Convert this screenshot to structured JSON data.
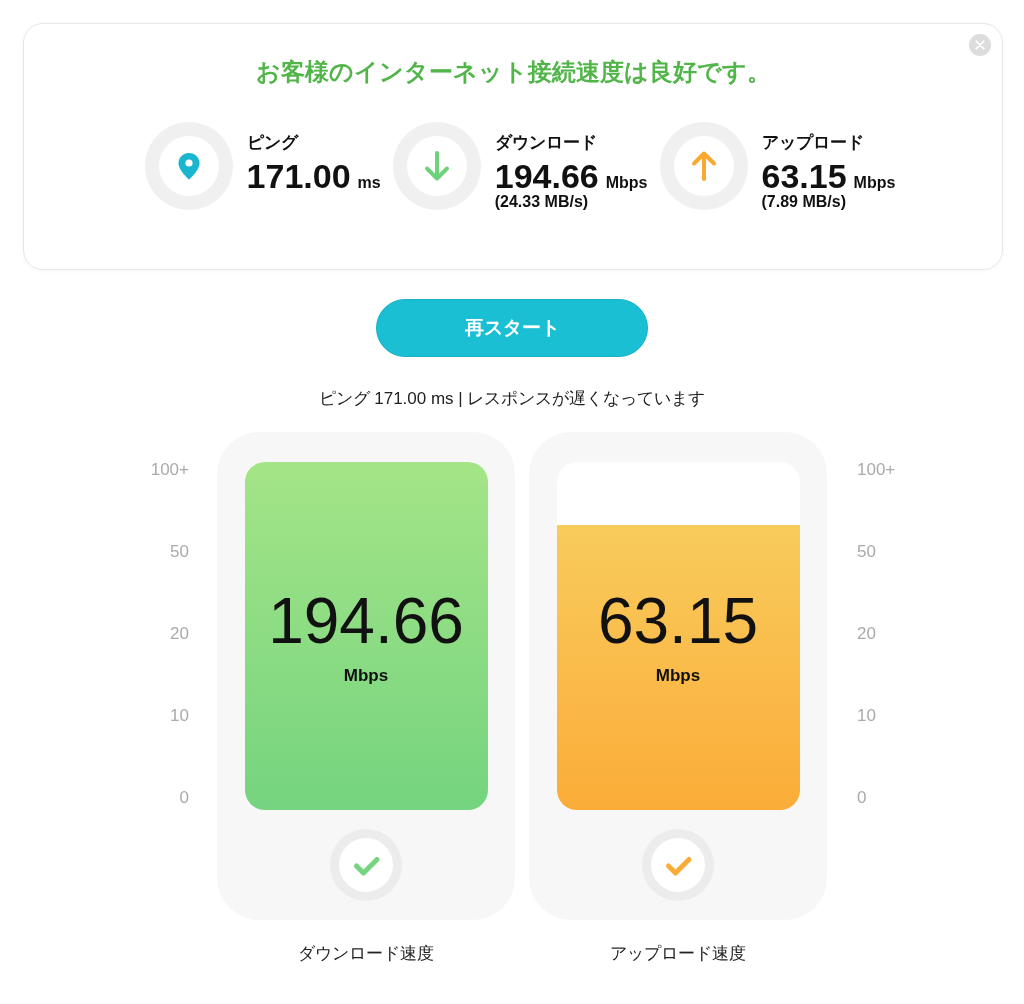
{
  "result_card": {
    "title": "お客様のインターネット接続速度は良好です。",
    "stats": [
      {
        "kind": "ping",
        "label": "ピング",
        "value": "171.00",
        "unit": "ms"
      },
      {
        "kind": "download",
        "label": "ダウンロード",
        "value": "194.66",
        "unit": "Mbps",
        "rate": "(24.33 MB/s)"
      },
      {
        "kind": "upload",
        "label": "アップロード",
        "value": "63.15",
        "unit": "Mbps",
        "rate": "(7.89 MB/s)"
      }
    ]
  },
  "restart_button": {
    "label": "再スタート"
  },
  "status_message": "ピング 171.00 ms | レスポンスが遅くなっています",
  "left_scale": [
    "100+",
    "50",
    "20",
    "10",
    "0"
  ],
  "gauges": [
    {
      "value": "194.66",
      "unit": "Mbps",
      "level": 1,
      "color": "#74d47f",
      "caption": "ダウンロード速度"
    },
    {
      "value": "63.15",
      "unit": "Mbps",
      "level": 0.82,
      "color": "#fbac38",
      "caption": "アップロード速度"
    }
  ],
  "right_scale": [
    "100+",
    "50",
    "20",
    "10",
    "0"
  ]
}
